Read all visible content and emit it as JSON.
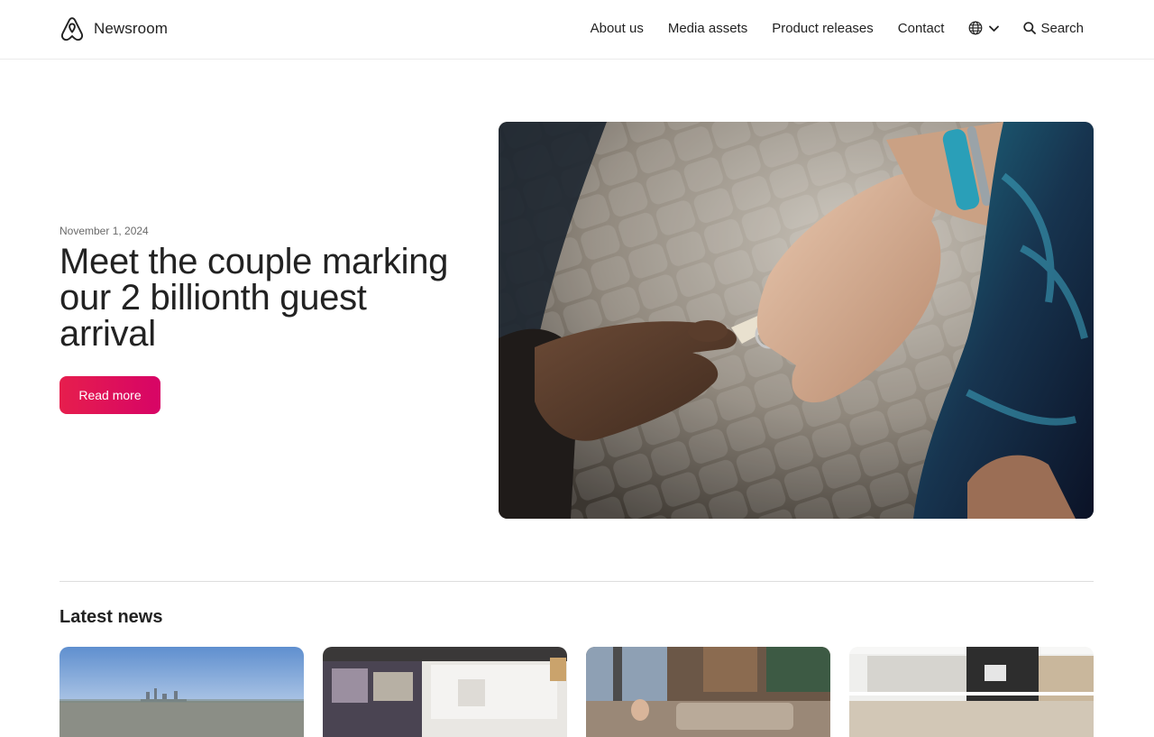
{
  "header": {
    "brand_name": "Newsroom",
    "logo_icon": "airbnb-belo-icon",
    "nav": [
      {
        "label": "About us"
      },
      {
        "label": "Media assets"
      },
      {
        "label": "Product releases"
      },
      {
        "label": "Contact"
      }
    ],
    "language_icon": "globe-icon",
    "search_label": "Search"
  },
  "hero": {
    "date": "November 1, 2024",
    "title": "Meet the couple marking our 2 billionth guest arrival",
    "cta_label": "Read more",
    "image_subject": "hands exchanging keys with red Airbnb keychain"
  },
  "latest": {
    "heading": "Latest news",
    "cards": [
      {
        "image_subject": "city skyline aerial view"
      },
      {
        "image_subject": "art gallery interior"
      },
      {
        "image_subject": "cozy living room"
      },
      {
        "image_subject": "modern building facade"
      }
    ]
  },
  "colors": {
    "brand": "#e31c5f",
    "text": "#222222",
    "muted": "#6a6a6a",
    "divider": "#dddddd"
  }
}
